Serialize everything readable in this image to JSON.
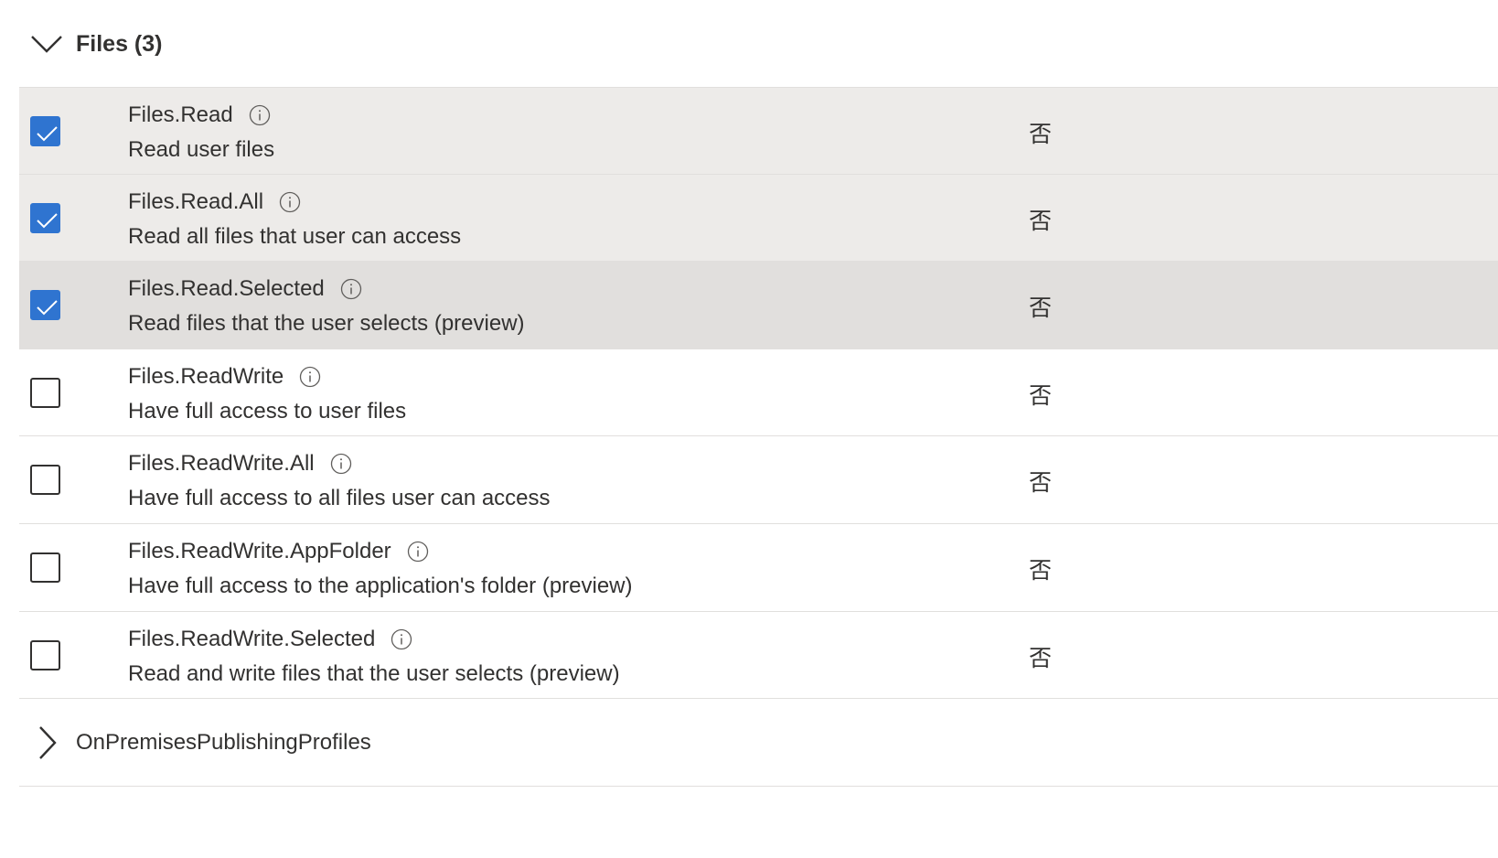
{
  "group": {
    "title": "Files (3)",
    "expanded": true
  },
  "permissions": [
    {
      "name": "Files.Read",
      "description": "Read user files",
      "admin_consent": "否",
      "checked": true
    },
    {
      "name": "Files.Read.All",
      "description": "Read all files that user can access",
      "admin_consent": "否",
      "checked": true
    },
    {
      "name": "Files.Read.Selected",
      "description": "Read files that the user selects (preview)",
      "admin_consent": "否",
      "checked": true
    },
    {
      "name": "Files.ReadWrite",
      "description": "Have full access to user files",
      "admin_consent": "否",
      "checked": false
    },
    {
      "name": "Files.ReadWrite.All",
      "description": "Have full access to all files user can access",
      "admin_consent": "否",
      "checked": false
    },
    {
      "name": "Files.ReadWrite.AppFolder",
      "description": "Have full access to the application's folder (preview)",
      "admin_consent": "否",
      "checked": false
    },
    {
      "name": "Files.ReadWrite.Selected",
      "description": "Read and write files that the user selects (preview)",
      "admin_consent": "否",
      "checked": false
    }
  ],
  "next_group": {
    "title": "OnPremisesPublishingProfiles",
    "expanded": false
  },
  "colors": {
    "checkbox_accent": "#2f74d0",
    "selected_row_bg": "#edebe9",
    "hover_row_bg": "#e1dfdd",
    "text": "#323130"
  },
  "icons": {
    "group_expand": "chevron-down-icon",
    "group_collapse": "chevron-right-icon",
    "info": "info-icon",
    "check": "checkmark-icon"
  }
}
